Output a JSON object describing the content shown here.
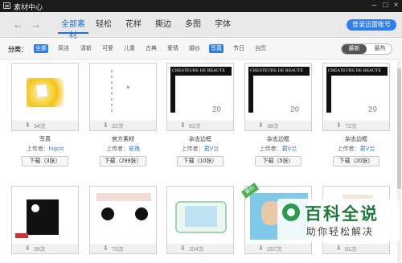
{
  "window": {
    "title": "素材中心"
  },
  "nav": {
    "tabs": [
      {
        "label": "全部素材"
      },
      {
        "label": "轻松"
      },
      {
        "label": "花样"
      },
      {
        "label": "撕边"
      },
      {
        "label": "多图"
      },
      {
        "label": "字体"
      }
    ],
    "active_tab": 0,
    "login_label": "登录迅雷账号"
  },
  "filters": {
    "label": "分类：",
    "chips": [
      {
        "label": "全部"
      },
      {
        "label": "简洁"
      },
      {
        "label": "清新"
      },
      {
        "label": "可爱"
      },
      {
        "label": "儿童"
      },
      {
        "label": "古典"
      },
      {
        "label": "爱情"
      },
      {
        "label": "婚纱"
      },
      {
        "label": "写真"
      },
      {
        "label": "节日"
      },
      {
        "label": "台历"
      }
    ],
    "active_chips": [
      "全部",
      "写真"
    ],
    "sort": [
      {
        "label": "最新"
      },
      {
        "label": "最热"
      }
    ],
    "active_sort": 0
  },
  "cards": [
    {
      "count": "34次",
      "name": "写真",
      "uploader_prefix": "上传者：",
      "uploader": "hujcct",
      "download": "下载（3张）"
    },
    {
      "count": "32次",
      "name": "官方素材",
      "uploader_prefix": "上传者：",
      "uploader": "安逸",
      "download": "下载（299张）"
    },
    {
      "count": "82次",
      "name": "杂志边框",
      "uploader_prefix": "上传者：",
      "uploader": "君V兰",
      "download": "下载（10张）",
      "thumb_text": "CREATEURS DE BEAUTE",
      "thumb_num": "20"
    },
    {
      "count": "38次",
      "name": "杂志边框",
      "uploader_prefix": "上传者：",
      "uploader": "君V兰",
      "download": "下载（5张）",
      "thumb_text": "CREATEURS DE BEAUTE",
      "thumb_num": "20"
    },
    {
      "count": "72次",
      "name": "杂志边框",
      "uploader_prefix": "上传者：",
      "uploader": "君V兰",
      "download": "下载（20张）",
      "thumb_text": "CREATEURS DE BEAUTE",
      "thumb_num": "20"
    },
    {
      "count": "39次"
    },
    {
      "count": "75次"
    },
    {
      "count": "254次"
    },
    {
      "count": "257次",
      "badge": "最热"
    },
    {
      "count": "91次"
    }
  ],
  "watermark": {
    "title": "百科全说",
    "subtitle": "助你轻松解决"
  },
  "colors": {
    "accent": "#2e7ee8",
    "titlebar": "#1b1b1b",
    "link": "#1e6fd9",
    "watermark_green": "#1f7a3c"
  }
}
